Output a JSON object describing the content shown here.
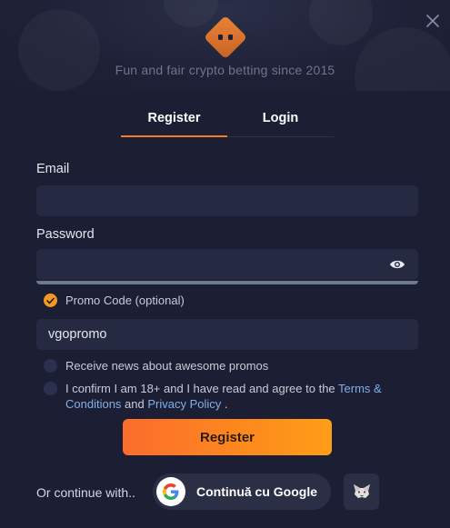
{
  "header": {
    "tagline": "Fun and fair crypto betting since 2015"
  },
  "tabs": [
    {
      "label": "Register",
      "active": true
    },
    {
      "label": "Login",
      "active": false
    }
  ],
  "form": {
    "email": {
      "label": "Email",
      "value": "",
      "placeholder": ""
    },
    "password": {
      "label": "Password",
      "value": "",
      "placeholder": ""
    },
    "promo": {
      "label": "Promo Code (optional)",
      "checked": true,
      "value": "vgopromo"
    },
    "newsletter": {
      "label": "Receive news about awesome promos",
      "checked": false
    },
    "terms": {
      "checked": false,
      "text_before": "I confirm I am 18+ and I have read and agree to the ",
      "terms_link": "Terms & Conditions",
      "text_middle": " and ",
      "privacy_link": "Privacy Policy",
      "text_after": " ."
    },
    "submit_label": "Register"
  },
  "social": {
    "continue_label": "Or continue with..",
    "google_label": "Continuă cu Google"
  },
  "colors": {
    "background": "#1c1f33",
    "field": "#252942",
    "accent": "#f47d26",
    "check_on": "#f49a22",
    "link": "#7fb0e8"
  },
  "icons": [
    "close-icon",
    "logo-dice-icon",
    "eye-icon",
    "checkmark-icon",
    "google-icon",
    "metamask-fox-icon"
  ]
}
